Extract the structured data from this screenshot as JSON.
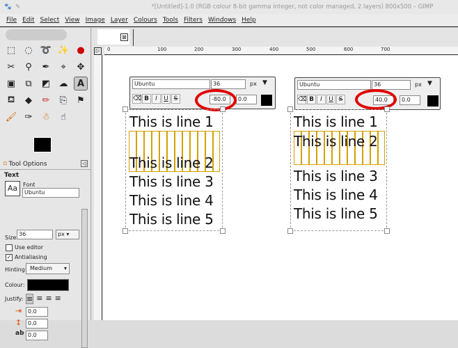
{
  "window": {
    "title": "*[Untitled]-1.0 (RGB colour 8-bit gamma integer, not color managed, 2 layers) 800x500 – GIMP"
  },
  "menu": [
    "File",
    "Edit",
    "Select",
    "View",
    "Image",
    "Layer",
    "Colours",
    "Tools",
    "Filters",
    "Windows",
    "Help"
  ],
  "ruler": {
    "ticks": [
      "0",
      "100",
      "200",
      "300",
      "400",
      "500",
      "600",
      "700"
    ]
  },
  "tool_options": {
    "tab": "Tool Options",
    "section": "Text",
    "font_label": "Font",
    "font": "Ubuntu",
    "size_label": "Size:",
    "size": "36",
    "unit": "px",
    "use_editor": "Use editor",
    "use_editor_checked": false,
    "antialiasing": "Antialiasing",
    "antialiasing_checked": true,
    "hinting_label": "Hinting:",
    "hinting": "Medium",
    "colour_label": "Colour:",
    "colour": "#000000",
    "justify_label": "Justify:",
    "indent": "0.0",
    "line_spacing": "0.0",
    "letter_spacing": "0.0"
  },
  "text_boxes": [
    {
      "font": "Ubuntu",
      "size": "36",
      "unit": "px",
      "baseline_offset": "-80.0",
      "kerning": "0.0",
      "lines": [
        "This is line 1",
        "This is line 2",
        "This is line 3",
        "This is line 4",
        "This is line 5"
      ]
    },
    {
      "font": "Ubuntu",
      "size": "36",
      "unit": "px",
      "baseline_offset": "40.0",
      "kerning": "0.0",
      "lines": [
        "This is line 1",
        "This is line 2",
        "This is line 3",
        "This is line 4",
        "This is line 5"
      ]
    }
  ],
  "colors": {
    "highlight": "#e00000",
    "selection": "#d4a000"
  }
}
